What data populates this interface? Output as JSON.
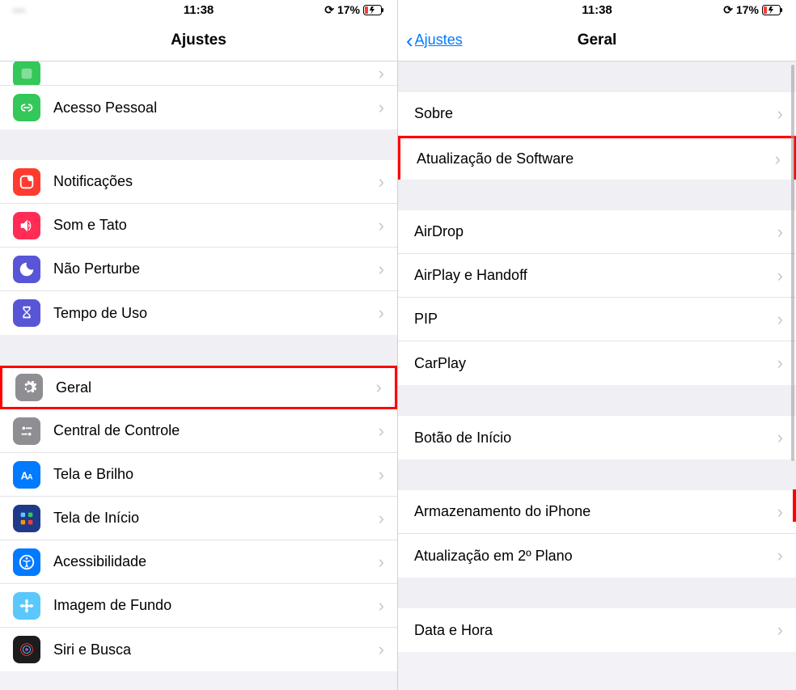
{
  "status": {
    "time": "11:38",
    "battery": "17%",
    "left_blur": "---"
  },
  "left": {
    "title": "Ajustes",
    "rows": {
      "partial_top": "",
      "personal_hotspot": "Acesso Pessoal",
      "notifications": "Notificações",
      "sounds": "Som e Tato",
      "dnd": "Não Perturbe",
      "screen_time": "Tempo de Uso",
      "general": "Geral",
      "control_center": "Central de Controle",
      "display": "Tela e Brilho",
      "home_screen": "Tela de Início",
      "accessibility": "Acessibilidade",
      "wallpaper": "Imagem de Fundo",
      "siri": "Siri e Busca"
    }
  },
  "right": {
    "back": "Ajustes",
    "title": "Geral",
    "rows": {
      "about": "Sobre",
      "software_update": "Atualização de Software",
      "airdrop": "AirDrop",
      "airplay": "AirPlay e Handoff",
      "pip": "PIP",
      "carplay": "CarPlay",
      "home_button": "Botão de Início",
      "storage": "Armazenamento do iPhone",
      "background_refresh": "Atualização em 2º Plano",
      "date_time": "Data e Hora"
    }
  },
  "colors": {
    "green": "#34c759",
    "red": "#ff3b30",
    "purple": "#5856d6",
    "indigo": "#5856d6",
    "gray": "#8e8e93",
    "blue": "#007aff",
    "darkblue": "#1e3a8a",
    "cyan": "#5ac8fa"
  }
}
